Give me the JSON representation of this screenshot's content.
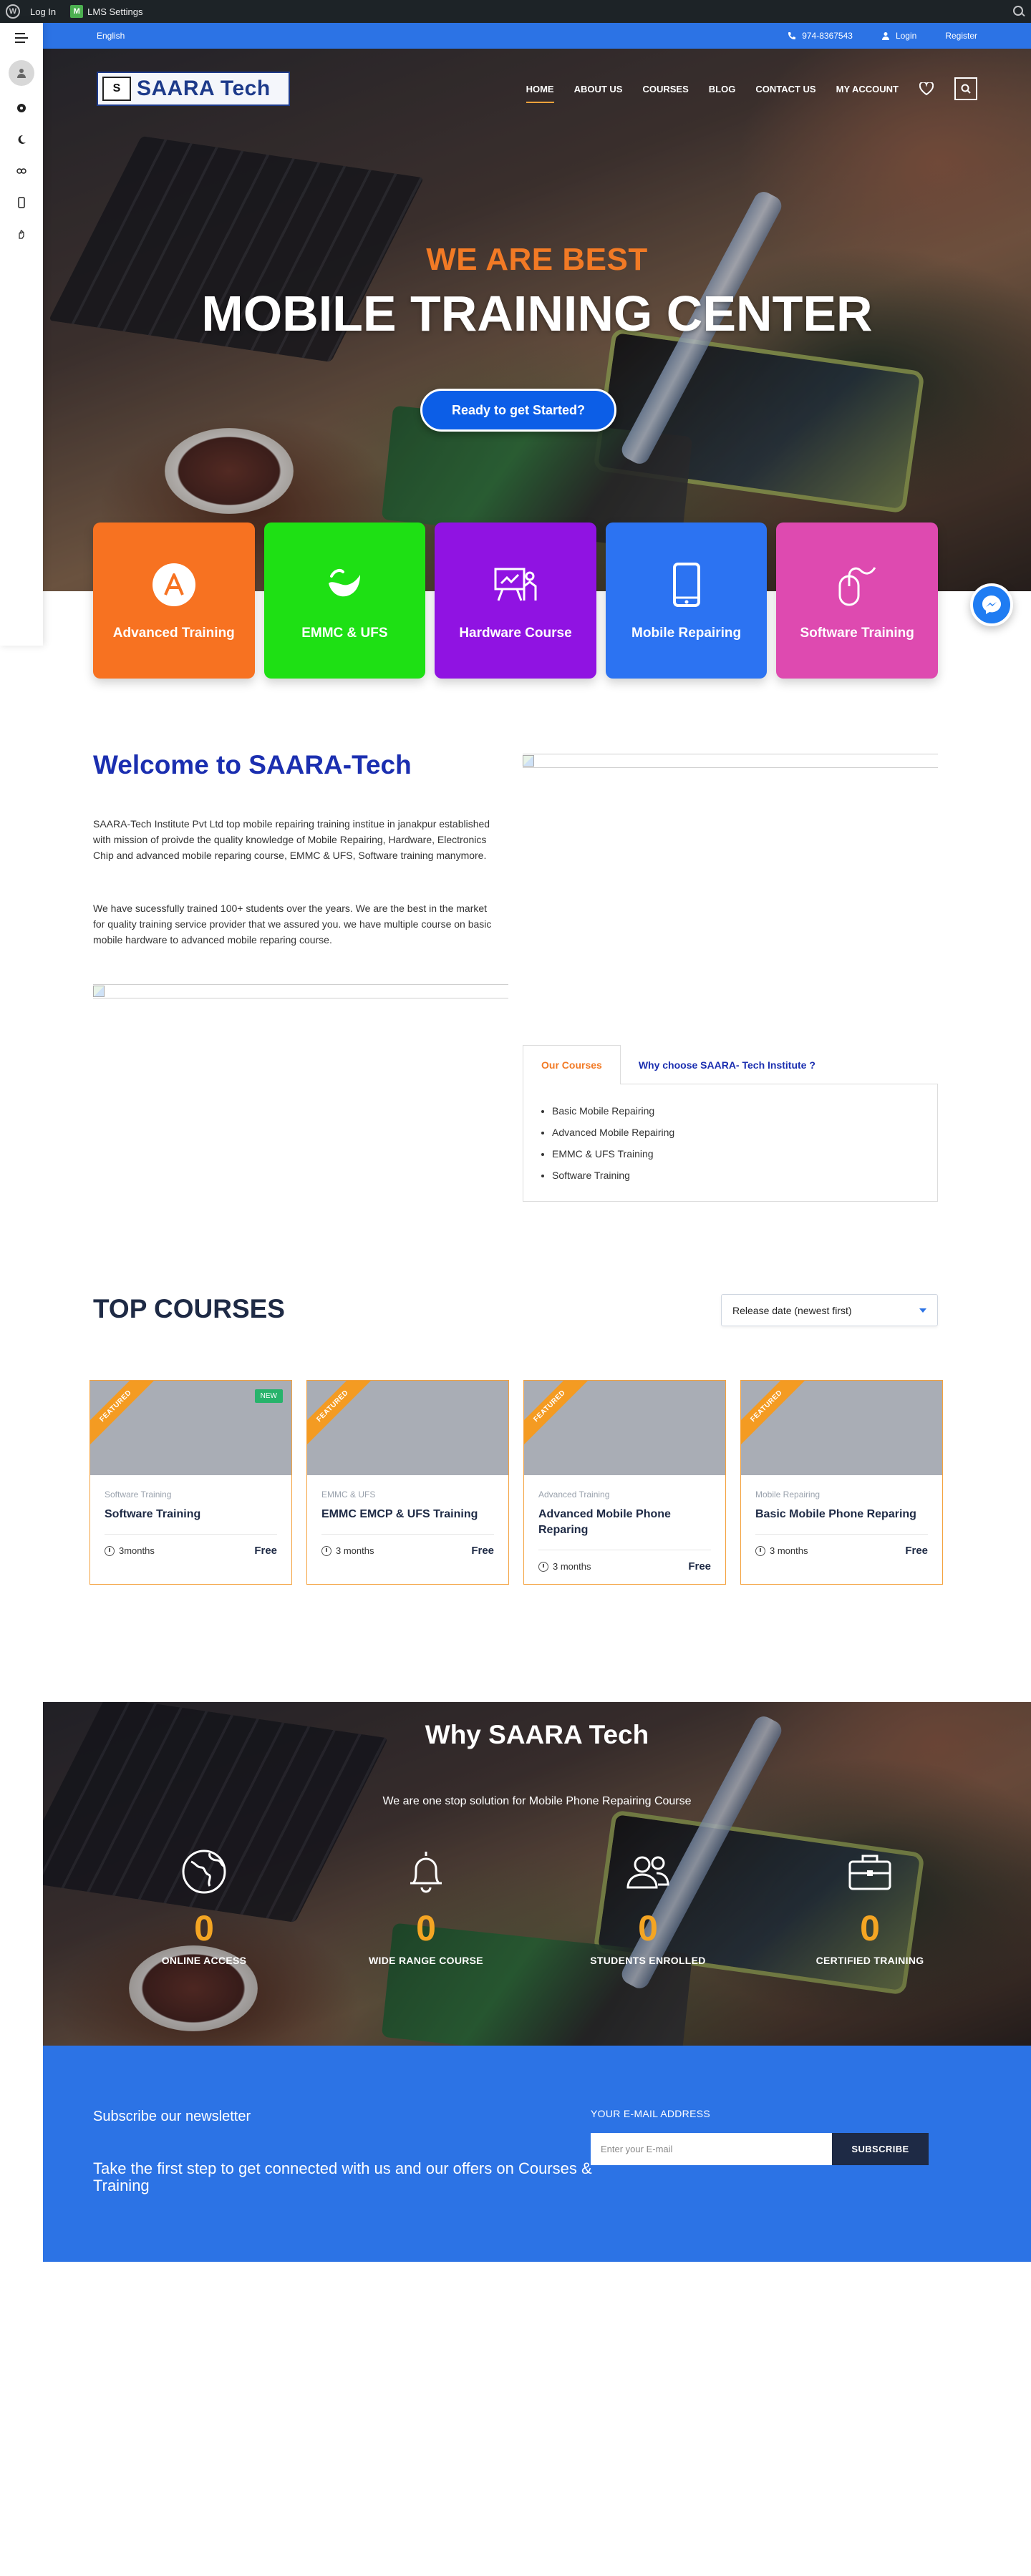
{
  "admin_bar": {
    "login": "Log In",
    "lms_settings": "LMS Settings"
  },
  "top_bar": {
    "language": "English",
    "phone": "974-8367543",
    "login": "Login",
    "register": "Register"
  },
  "header": {
    "logo_text": "SAARA Tech",
    "logo_mark": "S",
    "nav": [
      "HOME",
      "ABOUT US",
      "COURSES",
      "BLOG",
      "CONTACT US",
      "MY ACCOUNT"
    ]
  },
  "hero": {
    "subtitle": "WE ARE BEST",
    "title": "MOBILE TRAINING CENTER",
    "cta": "Ready to get Started?"
  },
  "categories": [
    {
      "label": "Advanced Training",
      "color": "#f77221",
      "icon": "advanced-a-icon"
    },
    {
      "label": "EMMC & UFS",
      "color": "#1ee014",
      "icon": "emmc-chip-icon"
    },
    {
      "label": "Hardware Course",
      "color": "#9013e2",
      "icon": "presenter-board-icon"
    },
    {
      "label": "Mobile Repairing",
      "color": "#2c73f2",
      "icon": "smartphone-icon"
    },
    {
      "label": "Software Training",
      "color": "#de4ab0",
      "icon": "mouse-icon"
    }
  ],
  "welcome": {
    "title": "Welcome to SAARA-Tech",
    "p1": "SAARA-Tech Institute Pvt Ltd top mobile repairing training institue in janakpur established with mission of proivde the quality knowledge of Mobile Repairing, Hardware, Electronics Chip and advanced mobile reparing course, EMMC & UFS, Software training manymore.",
    "p2": "We have sucessfully trained 100+ students over the years. We are the best in the market for quality training service provider that we assured you. we have multiple course on basic mobile hardware to advanced mobile reparing course."
  },
  "tabs": {
    "active": "Our Courses",
    "other": "Why choose SAARA- Tech Institute ?",
    "items": [
      "Basic Mobile Repairing",
      "Advanced Mobile Repairing",
      "EMMC & UFS Training",
      "Software Training"
    ]
  },
  "top_courses": {
    "title": "TOP COURSES",
    "sort": "Release date (newest first)",
    "ribbon": "FEATURED",
    "new_badge": "NEW",
    "items": [
      {
        "category": "Software Training",
        "name": "Software Training",
        "duration": "3months",
        "price": "Free"
      },
      {
        "category": "EMMC & UFS",
        "name": "EMMC EMCP & UFS Training",
        "duration": "3 months",
        "price": "Free"
      },
      {
        "category": "Advanced Training",
        "name": "Advanced Mobile Phone Reparing",
        "duration": "3 months",
        "price": "Free"
      },
      {
        "category": "Mobile Repairing",
        "name": "Basic Mobile Phone Reparing",
        "duration": "3 months",
        "price": "Free"
      }
    ]
  },
  "why": {
    "title": "Why SAARA Tech",
    "subtitle": "We are one stop solution for Mobile  Phone Repairing Course",
    "stats": [
      {
        "value": "0",
        "label": "ONLINE ACCESS",
        "icon": "globe-icon"
      },
      {
        "value": "0",
        "label": "WIDE RANGE COURSE",
        "icon": "bell-icon"
      },
      {
        "value": "0",
        "label": "STUDENTS ENROLLED",
        "icon": "users-icon"
      },
      {
        "value": "0",
        "label": "CERTIFIED TRAINING",
        "icon": "briefcase-icon"
      }
    ]
  },
  "newsletter": {
    "title": "Subscribe our newsletter",
    "tagline": "Take the first step to get connected with us and our offers on Courses & Training",
    "label": "YOUR E-MAIL ADDRESS",
    "placeholder": "Enter your E-mail",
    "button": "SUBSCRIBE"
  }
}
